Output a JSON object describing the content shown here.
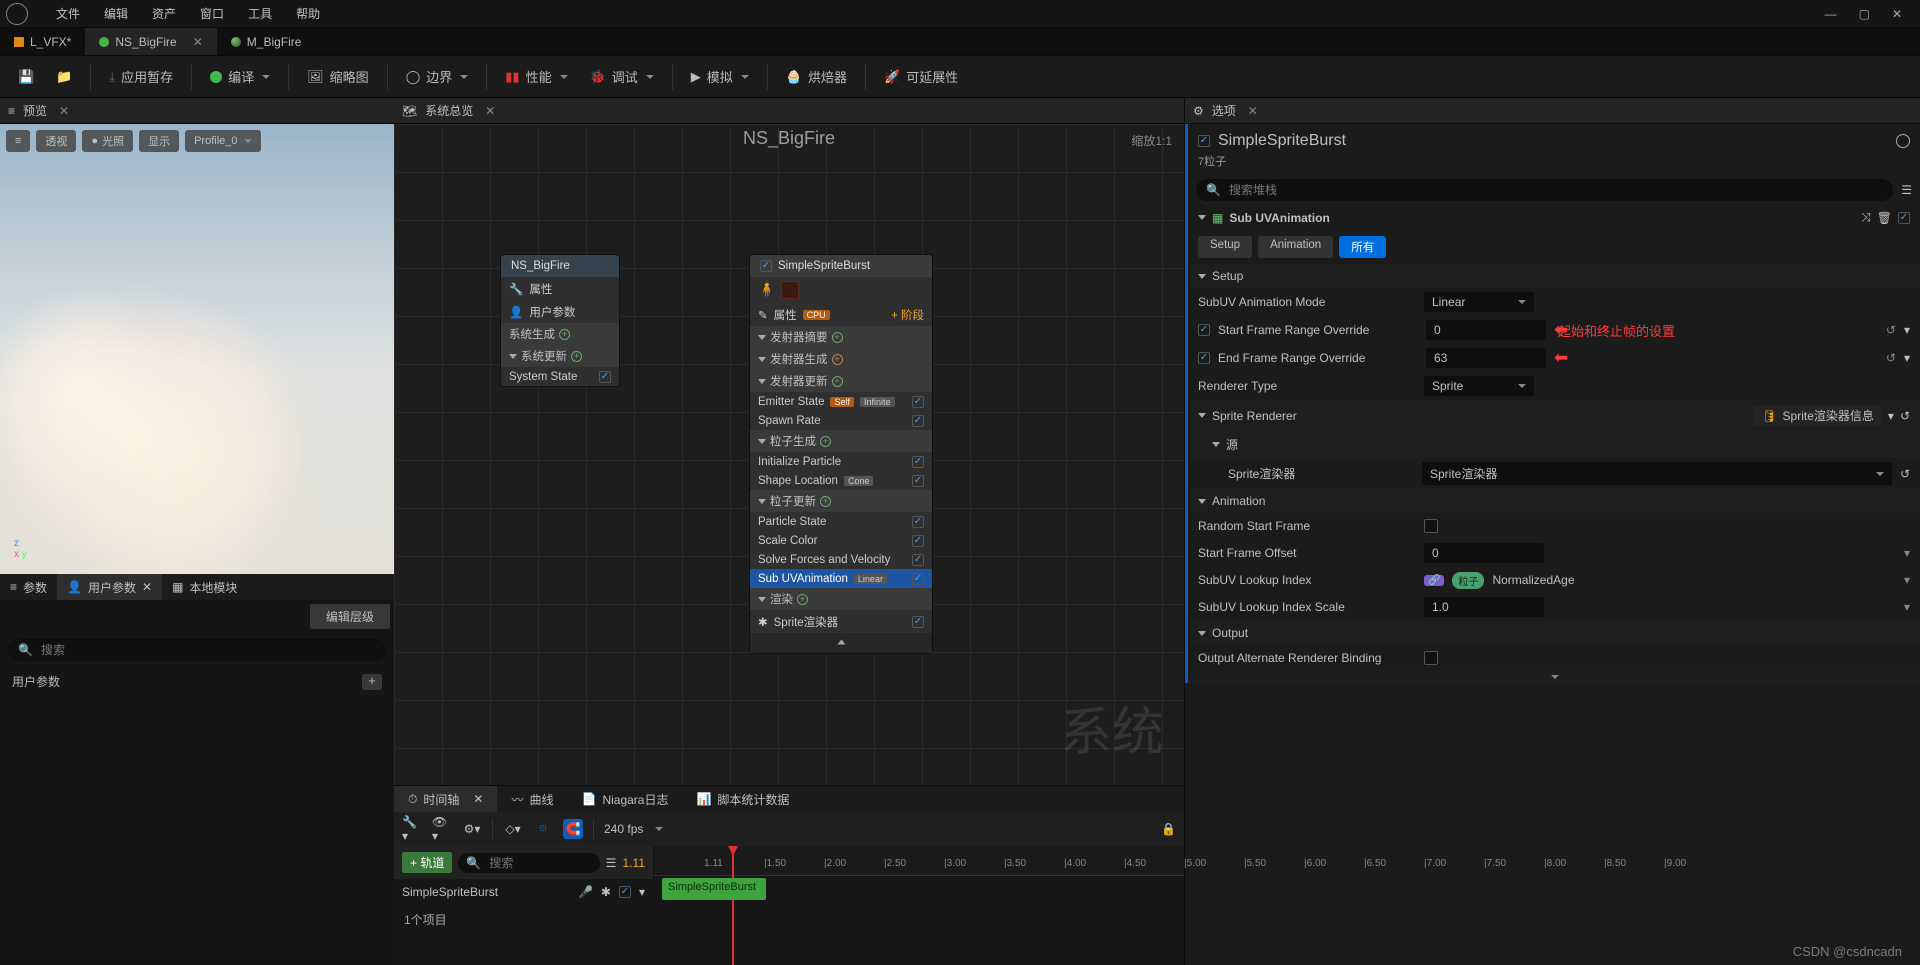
{
  "menus": [
    "文件",
    "编辑",
    "资产",
    "窗口",
    "工具",
    "帮助"
  ],
  "open_tabs": [
    {
      "label": "L_VFX*",
      "icon": "level"
    },
    {
      "label": "NS_BigFire",
      "icon": "niagara",
      "active": true
    },
    {
      "label": "M_BigFire",
      "icon": "material"
    }
  ],
  "toolbar": {
    "save": "保存",
    "browse": "浏览",
    "apply": "应用暂存",
    "compile": "编译",
    "thumbnail": "缩略图",
    "bounds": "边界",
    "performance": "性能",
    "debug": "调试",
    "simulate": "模拟",
    "baker": "烘焙器",
    "scalability": "可延展性"
  },
  "panels": {
    "preview": "预览",
    "overview": "系统总览",
    "details": "选项",
    "timeline": "时间轴",
    "curves": "曲线",
    "niagara_log": "Niagara日志",
    "script_stats": "脚本统计数据"
  },
  "preview": {
    "pills": [
      "透视",
      "光照",
      "显示",
      "Profile_0"
    ],
    "axes": [
      "z",
      "x",
      "y"
    ]
  },
  "params": {
    "tabs": [
      "参数",
      "用户参数",
      "本地模块"
    ],
    "edit_hierarchy": "编辑层级",
    "search_placeholder": "搜索",
    "user_params_label": "用户参数"
  },
  "graph": {
    "label": "NS_BigFire",
    "zoom": "缩放1:1",
    "bigword": "系统",
    "system_node": {
      "title": "NS_BigFire",
      "rows": [
        "属性",
        "用户参数"
      ],
      "sections": [
        {
          "name": "系统生成",
          "kind": "plus"
        },
        {
          "name": "系统更新",
          "kind": "arrow",
          "items": [
            "System State"
          ]
        }
      ]
    },
    "emitter_node": {
      "title": "SimpleSpriteBurst",
      "attr": "属性",
      "stage": "阶段",
      "sections": [
        {
          "name": "发射器摘要",
          "kind": "plus"
        },
        {
          "name": "发射器生成",
          "kind": "plus-empty"
        },
        {
          "name": "发射器更新",
          "kind": "plus",
          "items": [
            {
              "label": "Emitter State",
              "badges": [
                "Self",
                "Infinite"
              ]
            },
            {
              "label": "Spawn Rate"
            }
          ]
        },
        {
          "name": "粒子生成",
          "kind": "plus",
          "items": [
            {
              "label": "Initialize Particle"
            },
            {
              "label": "Shape Location",
              "badges": [
                "Cone"
              ]
            }
          ]
        },
        {
          "name": "粒子更新",
          "kind": "plus",
          "items": [
            {
              "label": "Particle State"
            },
            {
              "label": "Scale Color"
            },
            {
              "label": "Solve Forces and Velocity"
            },
            {
              "label": "Sub UVAnimation",
              "badges": [
                "Linear"
              ],
              "selected": true
            }
          ]
        },
        {
          "name": "渲染",
          "kind": "plus",
          "items": [
            {
              "label": "Sprite渲染器",
              "icon": "burst"
            }
          ]
        }
      ]
    }
  },
  "timeline": {
    "plus_track": "轨道",
    "search_placeholder": "搜索",
    "time_display": "1.11",
    "fps": "240 fps",
    "track": "SimpleSpriteBurst",
    "clip": "SimpleSpriteBurst",
    "ticks": [
      "1.11",
      "|1.50",
      "|2.00",
      "|2.50",
      "|3.00",
      "|3.50",
      "|4.00",
      "|4.50",
      "|5.00",
      "|5.50",
      "|6.00",
      "|6.50",
      "|7.00",
      "|7.50",
      "|8.00",
      "|8.50",
      "|9.00"
    ],
    "items_count": "1个项目"
  },
  "details": {
    "title": "SimpleSpriteBurst",
    "subtitle": "7粒子",
    "search_placeholder": "搜索堆栈",
    "module": "Sub UVAnimation",
    "tabs": [
      "Setup",
      "Animation",
      "所有"
    ],
    "active_tab": "所有",
    "annotation": "起始和终止帧的设置",
    "groups": {
      "setup": {
        "title": "Setup",
        "rows": [
          {
            "label": "SubUV Animation Mode",
            "type": "select",
            "value": "Linear"
          },
          {
            "label": "Start Frame Range Override",
            "type": "num_checked",
            "value": "0",
            "arrow": true
          },
          {
            "label": "End Frame Range Override",
            "type": "num_checked",
            "value": "63",
            "arrow": true
          },
          {
            "label": "Renderer Type",
            "type": "select",
            "value": "Sprite"
          }
        ]
      },
      "sprite_renderer": {
        "title": "Sprite Renderer",
        "info": "Sprite渲染器信息",
        "source_label": "源",
        "sprite_renderer_label": "Sprite渲染器",
        "value": "Sprite渲染器"
      },
      "animation": {
        "title": "Animation",
        "rows": [
          {
            "label": "Random Start Frame",
            "type": "check",
            "value": false
          },
          {
            "label": "Start Frame Offset",
            "type": "num",
            "value": "0"
          },
          {
            "label": "SubUV Lookup Index",
            "type": "link",
            "chip": "粒子",
            "value": "NormalizedAge"
          },
          {
            "label": "SubUV Lookup Index Scale",
            "type": "num",
            "value": "1.0"
          }
        ]
      },
      "output": {
        "title": "Output",
        "rows": [
          {
            "label": "Output Alternate Renderer Binding",
            "type": "check",
            "value": false
          }
        ]
      }
    }
  },
  "watermark": "CSDN @csdncadn"
}
